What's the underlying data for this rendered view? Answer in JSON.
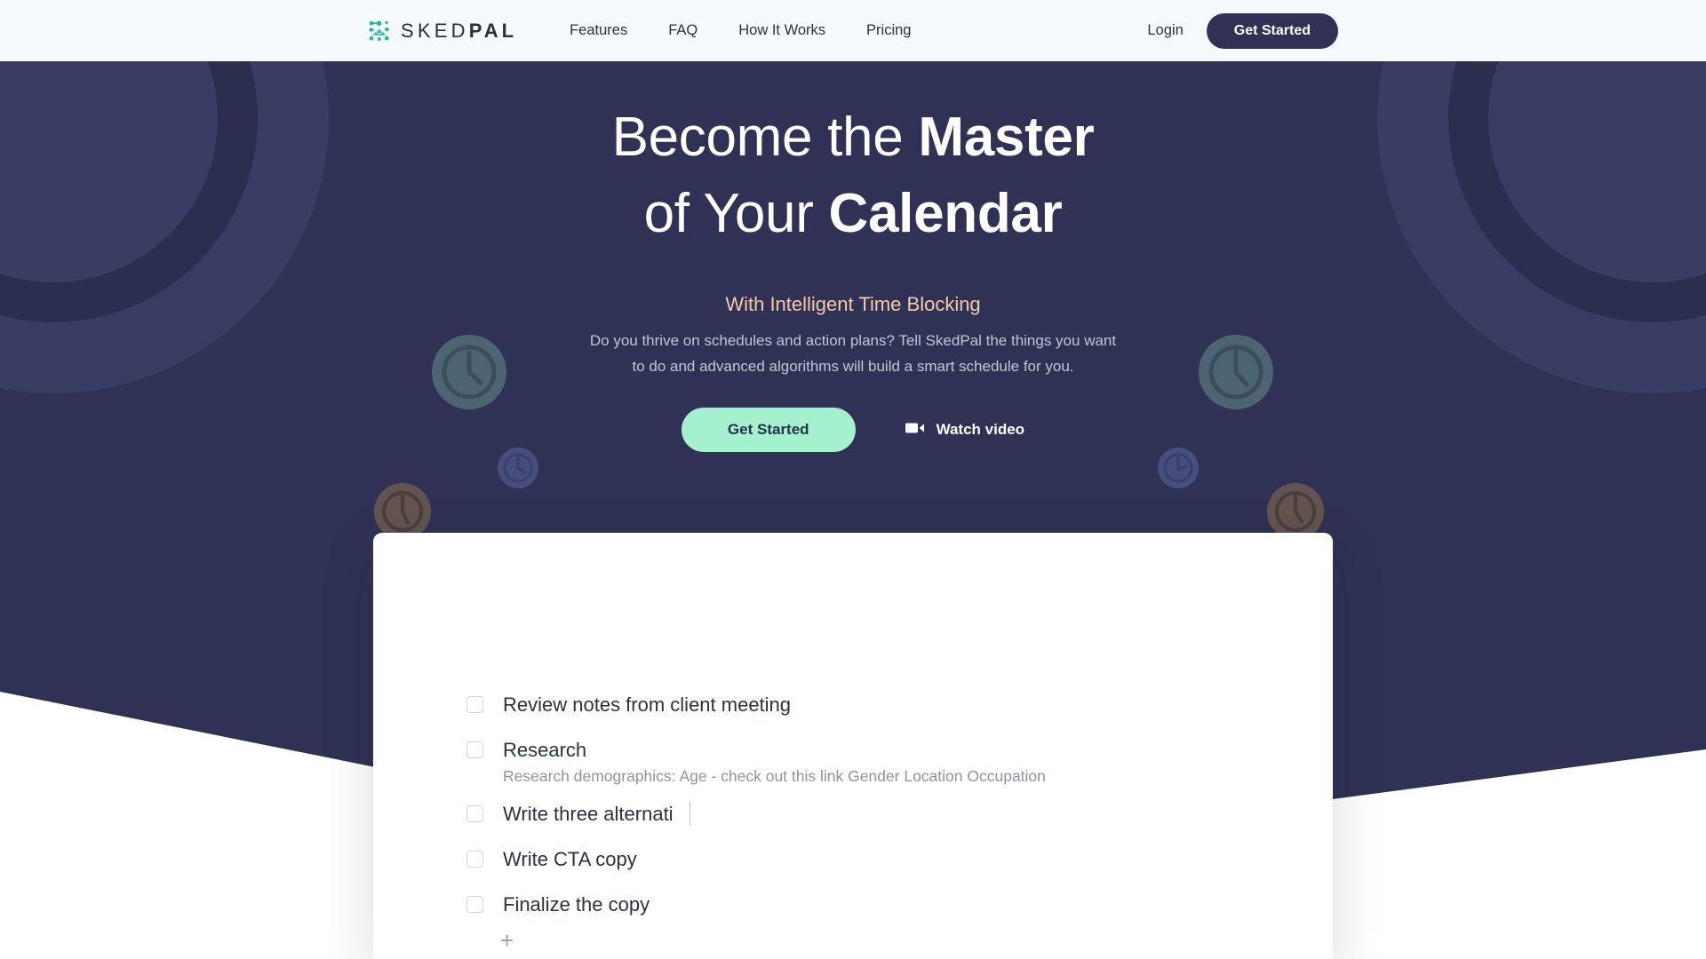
{
  "nav": {
    "brand": {
      "sked": "SKED",
      "pal": "PAL",
      "logo_icon": "skedpal-dots-logo"
    },
    "links": [
      {
        "label": "Features"
      },
      {
        "label": "FAQ"
      },
      {
        "label": "How It Works"
      },
      {
        "label": "Pricing"
      }
    ],
    "login_label": "Login",
    "cta_label": "Get Started"
  },
  "hero": {
    "heading_line1_light": "Become the ",
    "heading_line1_bold": "Master",
    "heading_line2_light": "of Your ",
    "heading_line2_bold": "Calendar",
    "eyebrow": "With Intelligent Time Blocking",
    "subtext": "Do you thrive on schedules and action plans? Tell SkedPal the things you want to do and advanced algorithms will build a smart schedule for you.",
    "cta_label": "Get Started",
    "watch_label": "Watch video",
    "watch_icon": "video-camera-icon"
  },
  "card": {
    "tasks": [
      {
        "title": "Review notes from client meeting",
        "note": null,
        "editing": false
      },
      {
        "title": "Research",
        "note": "Research demographics: Age - check out this link Gender Location Occupation",
        "editing": false
      },
      {
        "title": "Write three alternati",
        "note": null,
        "editing": true
      },
      {
        "title": "Write CTA copy",
        "note": null,
        "editing": false
      },
      {
        "title": "Finalize the copy",
        "note": null,
        "editing": false
      }
    ],
    "add_label": "+",
    "add_icon": "plus-icon"
  },
  "colors": {
    "navy": "#2f3254",
    "navbar_bg": "#f7fafd",
    "mint": "#a5f0cd",
    "peach": "#f5cba6",
    "logo_teal": "#2bb3b8",
    "text_dark": "#2b3044",
    "text_muted": "#8e93a3"
  }
}
